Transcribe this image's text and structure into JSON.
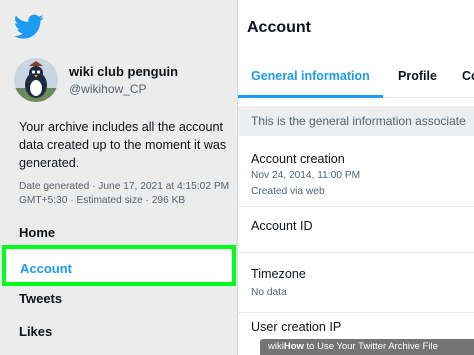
{
  "sidebar": {
    "logo_icon": "twitter-bird-icon",
    "profile": {
      "name": "wiki club penguin",
      "handle": "@wikihow_CP",
      "avatar_icon": "penguin-avatar-icon"
    },
    "archive_description": "Your archive includes all the account data created up to the moment it was generated.",
    "archive_meta": "Date generated · June 17, 2021 at 4:15:02 PM GMT+5:30 · Estimated size · 296 KB",
    "nav": {
      "home": "Home",
      "account": "Account",
      "tweets": "Tweets",
      "likes": "Likes"
    },
    "highlight_color": "#00ff1a"
  },
  "main": {
    "title": "Account",
    "tabs": {
      "general": "General information",
      "profile": "Profile",
      "more": "Co"
    },
    "info_banner": "This is the general information associate",
    "rows": {
      "creation": {
        "title": "Account creation",
        "date": "Nov 24, 2014, 11:00 PM",
        "via": "Created via web"
      },
      "account_id": {
        "title": "Account ID"
      },
      "timezone": {
        "title": "Timezone",
        "value": "No data"
      },
      "user_creation_ip": {
        "title": "User creation IP"
      }
    },
    "accent_color": "#1d9bf0"
  },
  "watermark": {
    "brand": "wiki",
    "how": "How",
    "rest": " to Use Your Twitter Archive File"
  }
}
